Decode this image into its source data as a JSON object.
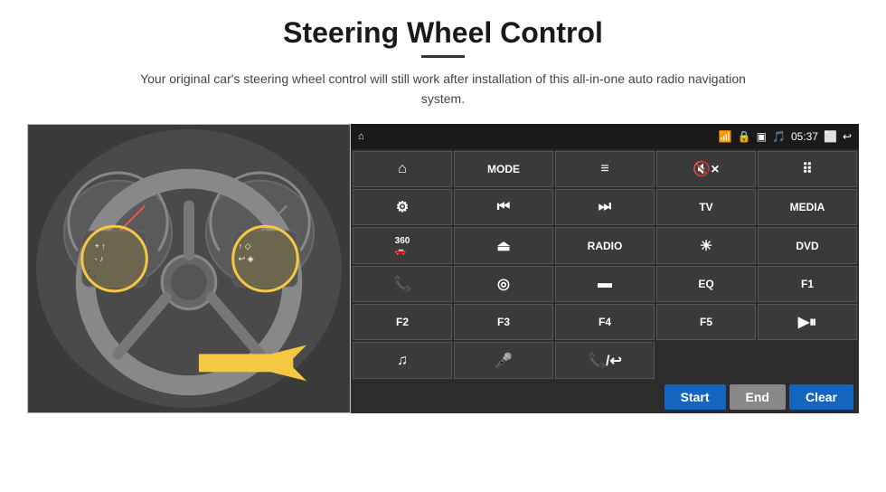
{
  "page": {
    "title": "Steering Wheel Control",
    "subtitle": "Your original car's steering wheel control will still work after installation of this all-in-one auto radio navigation system."
  },
  "status_bar": {
    "time": "05:37",
    "icons": [
      "wifi",
      "lock",
      "sim",
      "bluetooth",
      "cast",
      "back"
    ]
  },
  "buttons": [
    {
      "row": 1,
      "cells": [
        {
          "icon": "home",
          "text": "⌂"
        },
        {
          "text": "MODE"
        },
        {
          "icon": "list",
          "text": "≡"
        },
        {
          "icon": "mute",
          "text": "🔇×"
        },
        {
          "icon": "grid",
          "text": "⠿"
        }
      ]
    },
    {
      "row": 2,
      "cells": [
        {
          "icon": "settings",
          "text": "⚙"
        },
        {
          "icon": "prev",
          "text": "⏮"
        },
        {
          "icon": "next",
          "text": "⏭"
        },
        {
          "text": "TV"
        },
        {
          "text": "MEDIA"
        }
      ]
    },
    {
      "row": 3,
      "cells": [
        {
          "icon": "360",
          "text": "360"
        },
        {
          "icon": "eject",
          "text": "⏏"
        },
        {
          "text": "RADIO"
        },
        {
          "icon": "brightness",
          "text": "☀"
        },
        {
          "text": "DVD"
        }
      ]
    },
    {
      "row": 4,
      "cells": [
        {
          "icon": "phone",
          "text": "📞"
        },
        {
          "icon": "nav",
          "text": "◎"
        },
        {
          "icon": "rect",
          "text": "▬"
        },
        {
          "text": "EQ"
        },
        {
          "text": "F1"
        }
      ]
    },
    {
      "row": 5,
      "cells": [
        {
          "text": "F2"
        },
        {
          "text": "F3"
        },
        {
          "text": "F4"
        },
        {
          "text": "F5"
        },
        {
          "icon": "playpause",
          "text": "▶⏸"
        }
      ]
    },
    {
      "row": 6,
      "cells": [
        {
          "icon": "music",
          "text": "♪"
        },
        {
          "icon": "mic",
          "text": "🎤"
        },
        {
          "icon": "phonecall",
          "text": "📞/↩"
        }
      ]
    }
  ],
  "bottom_bar": {
    "start_label": "Start",
    "end_label": "End",
    "clear_label": "Clear"
  }
}
